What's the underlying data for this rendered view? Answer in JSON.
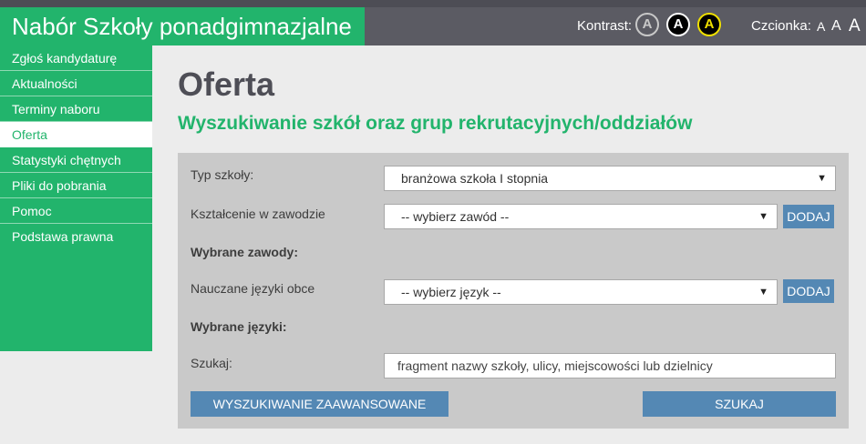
{
  "header": {
    "title": "Nabór Szkoły ponadgimnazjalne",
    "contrast_label": "Kontrast:",
    "contrast_buttons": [
      "A",
      "A",
      "A"
    ],
    "font_label": "Czcionka:",
    "font_sizes": [
      "A",
      "A",
      "A"
    ]
  },
  "sidebar": {
    "items": [
      {
        "label": "Zgłoś kandydaturę"
      },
      {
        "label": "Aktualności"
      },
      {
        "label": "Terminy naboru"
      },
      {
        "label": "Oferta"
      },
      {
        "label": "Statystyki chętnych"
      },
      {
        "label": "Pliki do pobrania"
      },
      {
        "label": "Pomoc"
      },
      {
        "label": "Podstawa prawna"
      }
    ],
    "active_index": 3
  },
  "main": {
    "title": "Oferta",
    "subtitle": "Wyszukiwanie szkół oraz grup rekrutacyjnych/oddziałów"
  },
  "form": {
    "school_type_label": "Typ szkoły:",
    "school_type_value": "branżowa szkoła I stopnia",
    "profession_label": "Kształcenie w zawodzie",
    "profession_value": "-- wybierz zawód --",
    "add_label": "DODAJ",
    "selected_professions_label": "Wybrane zawody:",
    "languages_label": "Nauczane języki obce",
    "language_value": "-- wybierz język --",
    "selected_languages_label": "Wybrane języki:",
    "search_label": "Szukaj:",
    "search_placeholder": "fragment nazwy szkoły, ulicy, miejscowości lub dzielnicy",
    "advanced_button": "WYSZUKIWANIE ZAAWANSOWANE",
    "search_button": "SZUKAJ"
  },
  "colors": {
    "brand_green": "#22b46c",
    "topbar_gray": "#5b5b63",
    "button_blue": "#5488b4",
    "form_gray": "#c9c9c9"
  }
}
